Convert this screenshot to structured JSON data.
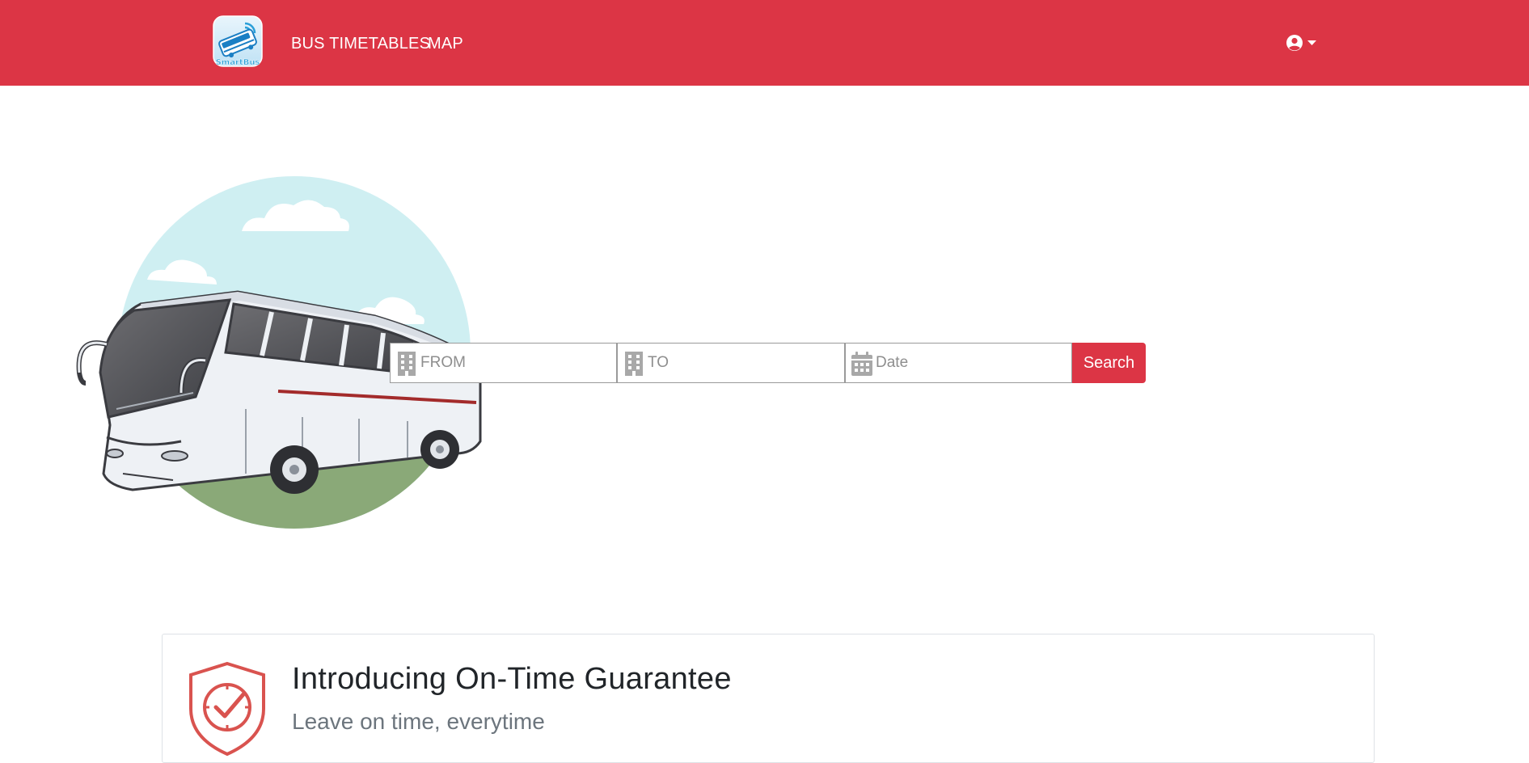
{
  "navbar": {
    "brand": {
      "logo_text": "SmartBus",
      "icon": "smartbus-logo-icon"
    },
    "links": [
      {
        "label": "BUS TIMETABLES"
      },
      {
        "label": "MAP"
      }
    ],
    "user_menu": {
      "icon": "user-circle-icon",
      "caret": "caret-down-icon"
    }
  },
  "search": {
    "from": {
      "placeholder": "FROM",
      "value": "",
      "icon": "building-icon"
    },
    "to": {
      "placeholder": "TO",
      "value": "",
      "icon": "building-icon"
    },
    "date": {
      "placeholder": "Date",
      "value": "",
      "icon": "calendar-icon"
    },
    "button_label": "Search"
  },
  "guarantee": {
    "title": "Introducing On-Time Guarantee",
    "subtitle": "Leave on time, everytime",
    "icon": "shield-clock-check-icon"
  },
  "colors": {
    "brand_red": "#dc3545",
    "sky": "#cfeff2",
    "grass": "#8aa978",
    "field_border": "#9a9a9a",
    "placeholder": "#8e8e8e",
    "subtitle": "#6c757d"
  }
}
